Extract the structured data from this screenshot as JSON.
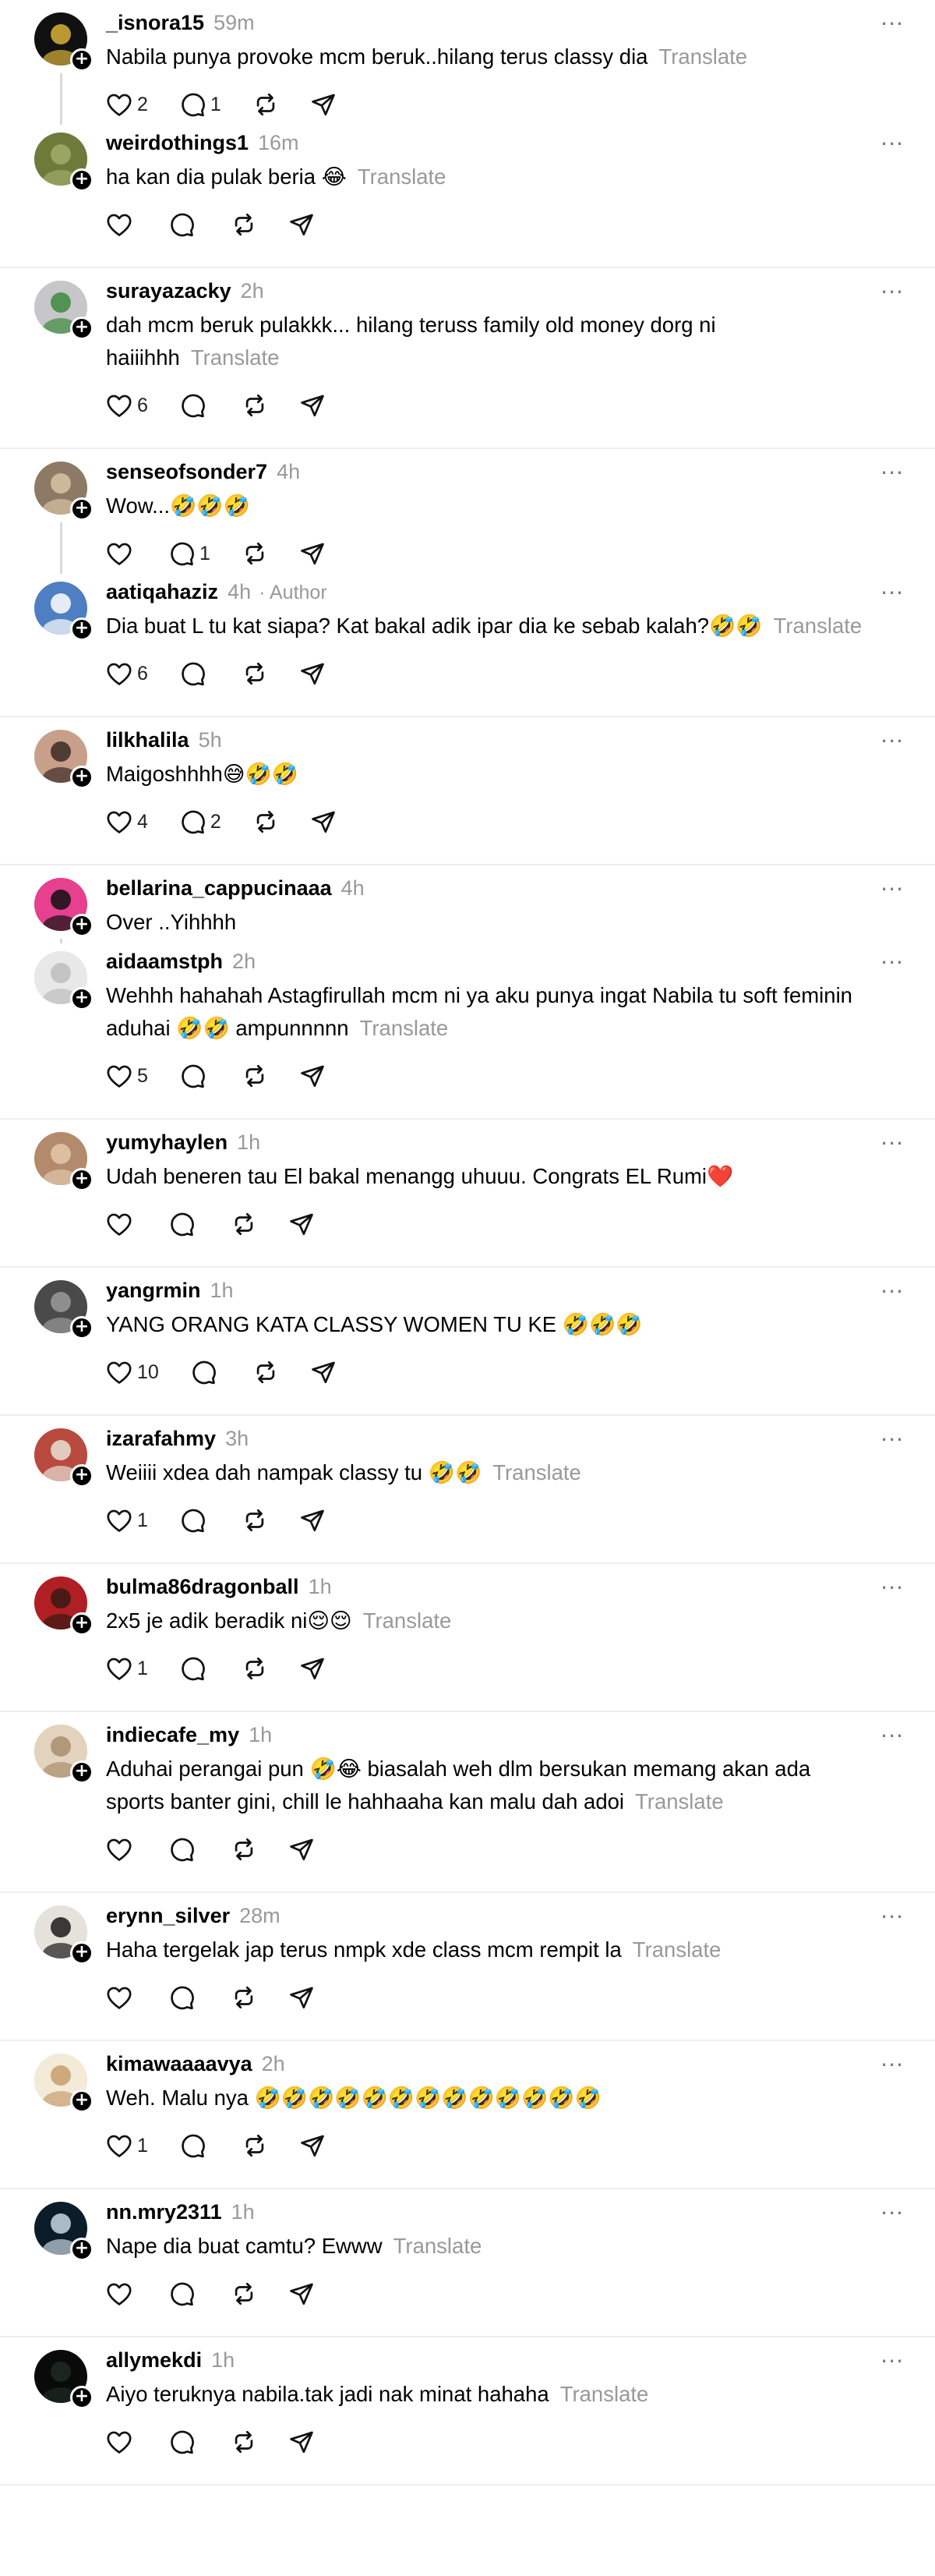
{
  "translate_label": "Translate",
  "groups": [
    {
      "posts": [
        {
          "username": "_isnora15",
          "time": "59m",
          "text": "Nabila punya provoke mcm beruk..hilang terus classy dia",
          "translate": true,
          "likes": "2",
          "replies": "1",
          "avatar_color": "#111111",
          "avatar_accent": "#d8b23a"
        },
        {
          "username": "weirdothings1",
          "time": "16m",
          "text": "ha kan dia pulak beria 😂",
          "translate": true,
          "likes": "",
          "replies": "",
          "avatar_color": "#6d7a3a",
          "avatar_accent": "#a3ad6b"
        }
      ]
    },
    {
      "posts": [
        {
          "username": "surayazacky",
          "time": "2h",
          "text": "dah mcm beruk pulakkk... hilang teruss family old money dorg ni haiiihhh",
          "translate": true,
          "likes": "6",
          "replies": "",
          "avatar_color": "#c7c7c9",
          "avatar_accent": "#3d8a3f"
        }
      ]
    },
    {
      "posts": [
        {
          "username": "senseofsonder7",
          "time": "4h",
          "text": "Wow...🤣🤣🤣",
          "translate": false,
          "likes": "",
          "replies": "1",
          "avatar_color": "#8c7a66",
          "avatar_accent": "#d8c3a6"
        },
        {
          "username": "aatiqahaziz",
          "time": "4h",
          "author": "· Author",
          "text": "Dia buat L tu kat siapa? Kat bakal adik ipar dia ke sebab kalah?🤣🤣",
          "translate": true,
          "likes": "6",
          "replies": "",
          "avatar_color": "#4d7fc2",
          "avatar_accent": "#ffffff"
        }
      ]
    },
    {
      "posts": [
        {
          "username": "lilkhalila",
          "time": "5h",
          "text": "Maigoshhhh😅🤣🤣",
          "translate": false,
          "likes": "4",
          "replies": "2",
          "avatar_color": "#c8a089",
          "avatar_accent": "#3a2a25"
        }
      ]
    },
    {
      "posts": [
        {
          "username": "bellarina_cappucinaaa",
          "time": "4h",
          "text": "Over ..Yihhhh",
          "translate": false,
          "likes": null,
          "replies": null,
          "avatar_color": "#e6408e",
          "avatar_accent": "#111111"
        },
        {
          "username": "aidaamstph",
          "time": "2h",
          "text": "Wehhh hahahah Astagfirullah mcm ni ya aku punya ingat Nabila tu soft feminin aduhai 🤣🤣 ampunnnnn",
          "translate": true,
          "likes": "5",
          "replies": "",
          "avatar_color": "#e8e8e8",
          "avatar_accent": "#bdbdbd"
        }
      ]
    },
    {
      "posts": [
        {
          "username": "yumyhaylen",
          "time": "1h",
          "text": "Udah beneren tau El bakal menangg uhuuu. Congrats EL Rumi❤️",
          "translate": false,
          "likes": "",
          "replies": "",
          "avatar_color": "#b38a6b",
          "avatar_accent": "#e4c7aa"
        }
      ]
    },
    {
      "posts": [
        {
          "username": "yangrmin",
          "time": "1h",
          "text": "YANG ORANG KATA CLASSY WOMEN TU KE 🤣🤣🤣",
          "translate": false,
          "likes": "10",
          "replies": "",
          "avatar_color": "#4a4a4a",
          "avatar_accent": "#9a9a9a"
        }
      ]
    },
    {
      "posts": [
        {
          "username": "izarafahmy",
          "time": "3h",
          "text": "Weiiii xdea dah nampak classy tu 🤣🤣",
          "translate": true,
          "likes": "1",
          "replies": "",
          "avatar_color": "#b94a3f",
          "avatar_accent": "#e7e0d5"
        }
      ]
    },
    {
      "posts": [
        {
          "username": "bulma86dragonball",
          "time": "1h",
          "text": "2x5 je adik beradik ni😌😌",
          "translate": true,
          "likes": "1",
          "replies": "",
          "avatar_color": "#b01f24",
          "avatar_accent": "#3a1a14"
        }
      ]
    },
    {
      "posts": [
        {
          "username": "indiecafe_my",
          "time": "1h",
          "text": "Aduhai perangai pun 🤣😂 biasalah weh dlm bersukan memang akan ada sports banter gini, chill le hahhaaha kan malu dah adoi",
          "translate": true,
          "likes": "",
          "replies": "",
          "avatar_color": "#e3d3bd",
          "avatar_accent": "#a88d6c"
        }
      ]
    },
    {
      "posts": [
        {
          "username": "erynn_silver",
          "time": "28m",
          "text": "Haha tergelak jap terus nmpk xde class mcm rempit la",
          "translate": true,
          "likes": "",
          "replies": "",
          "avatar_color": "#e5e2dc",
          "avatar_accent": "#1b1b1b"
        }
      ]
    },
    {
      "posts": [
        {
          "username": "kimawaaaavya",
          "time": "2h",
          "text": "Weh. Malu nya 🤣🤣🤣🤣🤣🤣🤣🤣🤣🤣🤣🤣🤣",
          "translate": false,
          "likes": "1",
          "replies": "",
          "avatar_color": "#f4ead8",
          "avatar_accent": "#c79e6d"
        }
      ]
    },
    {
      "posts": [
        {
          "username": "nn.mry2311",
          "time": "1h",
          "text": "Nape dia buat camtu? Ewww",
          "translate": true,
          "likes": "",
          "replies": "",
          "avatar_color": "#0c1d2a",
          "avatar_accent": "#c9d6e0"
        }
      ]
    },
    {
      "posts": [
        {
          "username": "allymekdi",
          "time": "1h",
          "text": "Aiyo teruknya nabila.tak jadi nak minat hahaha",
          "translate": true,
          "likes": "",
          "replies": "",
          "avatar_color": "#0a0a0a",
          "avatar_accent": "#1e2a22"
        }
      ]
    }
  ]
}
